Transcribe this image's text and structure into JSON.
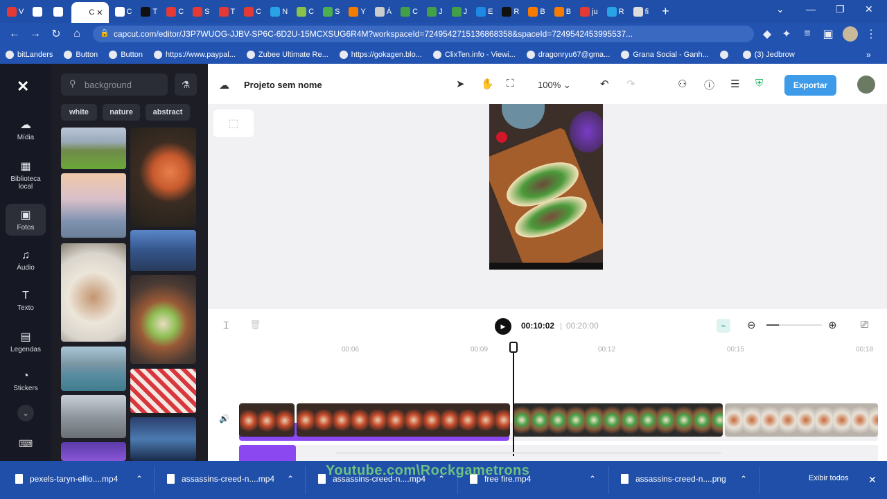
{
  "browser": {
    "tabs": [
      {
        "label": "V",
        "color": "#e53935"
      },
      {
        "label": "",
        "color": "#ffffff"
      },
      {
        "label": "",
        "color": "#ffffff"
      },
      {
        "label": "C",
        "color": "#ffffff",
        "active": true
      },
      {
        "label": "C",
        "color": "#ffffff"
      },
      {
        "label": "T",
        "color": "#111111"
      },
      {
        "label": "C",
        "color": "#e53935"
      },
      {
        "label": "S",
        "color": "#e53935"
      },
      {
        "label": "T",
        "color": "#e53935"
      },
      {
        "label": "C",
        "color": "#e53935"
      },
      {
        "label": "N",
        "color": "#29a3e6"
      },
      {
        "label": "C",
        "color": "#8bc34a"
      },
      {
        "label": "S",
        "color": "#4caf50"
      },
      {
        "label": "Y",
        "color": "#f57c00"
      },
      {
        "label": "Á",
        "color": "#cccccc"
      },
      {
        "label": "C",
        "color": "#43a047"
      },
      {
        "label": "J",
        "color": "#43a047"
      },
      {
        "label": "J",
        "color": "#43a047"
      },
      {
        "label": "E",
        "color": "#1e88e5"
      },
      {
        "label": "R",
        "color": "#111111"
      },
      {
        "label": "B",
        "color": "#f57c00"
      },
      {
        "label": "B",
        "color": "#f57c00"
      },
      {
        "label": "ju",
        "color": "#e53935"
      },
      {
        "label": "R",
        "color": "#29a3e6"
      },
      {
        "label": "fi",
        "color": "#dddddd"
      }
    ],
    "url": "capcut.com/editor/J3P7WUOG-JJBV-SP6C-6D2U-15MCXSUG6R4M?workspaceId=7249542715136868358&spaceId=7249542453995537...",
    "bookmarks": [
      {
        "label": "bitLanders"
      },
      {
        "label": "Button"
      },
      {
        "label": "Button"
      },
      {
        "label": "https://www.paypal..."
      },
      {
        "label": "Zubee Ultimate Re..."
      },
      {
        "label": "https://gokagen.blo..."
      },
      {
        "label": "ClixTen.info - Viewi..."
      },
      {
        "label": "dragonryu67@gma..."
      },
      {
        "label": "Grana Social - Ganh..."
      },
      {
        "label": ""
      },
      {
        "label": "(3) Jedbrow"
      }
    ]
  },
  "rail": {
    "items": [
      {
        "label": "Mídia",
        "icon": "cloud-upload-icon"
      },
      {
        "label": "Biblioteca local",
        "icon": "film-icon"
      },
      {
        "label": "Fotos",
        "icon": "image-icon"
      },
      {
        "label": "Áudio",
        "icon": "music-icon"
      },
      {
        "label": "Texto",
        "icon": "text-icon"
      },
      {
        "label": "Legendas",
        "icon": "captions-icon"
      },
      {
        "label": "Stickers",
        "icon": "sticker-icon"
      }
    ]
  },
  "panel": {
    "search_value": "background",
    "chips": [
      "white",
      "nature",
      "abstract"
    ]
  },
  "topbar": {
    "project_name": "Projeto sem nome",
    "zoom": "100%",
    "export_label": "Exportar"
  },
  "timeline": {
    "current_time": "00:10:02",
    "duration": "00:20:00",
    "ruler_labels": [
      "00:06",
      "00:09",
      "00:12",
      "00:15",
      "00:18"
    ]
  },
  "downloads": {
    "items": [
      {
        "label": "pexels-taryn-ellio....mp4"
      },
      {
        "label": "assassins-creed-n....mp4"
      },
      {
        "label": "assassins-creed-n....mp4"
      },
      {
        "label": "free fire.mp4"
      },
      {
        "label": "assassins-creed-n....png"
      }
    ],
    "show_all": "Exibir todos"
  },
  "watermark": "Youtube.com\\Rockgametrons",
  "colors": {
    "accent": "#3d9be9",
    "audio_bar": "#8b47f0",
    "browser": "#1f4fa8"
  }
}
